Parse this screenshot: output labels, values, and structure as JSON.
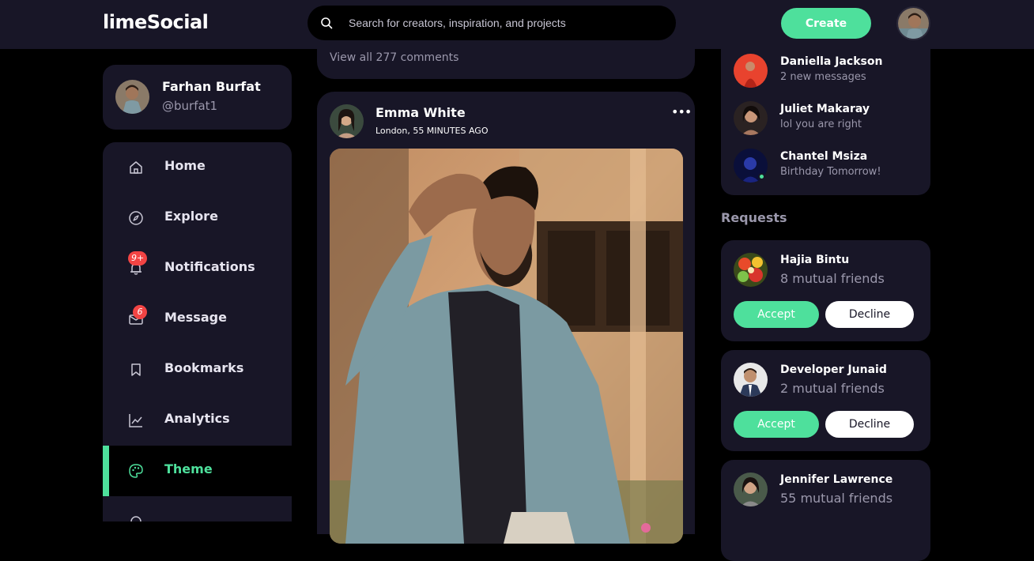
{
  "app": {
    "logo": "limeSocial",
    "accent": "#4ee09c",
    "surface": "#181627",
    "background": "#000000"
  },
  "header": {
    "search_placeholder": "Search for creators, inspiration, and projects",
    "create_label": "Create"
  },
  "profile": {
    "name": "Farhan Burfat",
    "handle": "@burfat1"
  },
  "sidebar": {
    "items": [
      {
        "label": "Home",
        "icon": "home-icon"
      },
      {
        "label": "Explore",
        "icon": "compass-icon"
      },
      {
        "label": "Notifications",
        "icon": "bell-icon",
        "badge": "9+"
      },
      {
        "label": "Message",
        "icon": "mail-icon",
        "badge": "6"
      },
      {
        "label": "Bookmarks",
        "icon": "bookmark-icon"
      },
      {
        "label": "Analytics",
        "icon": "analytics-icon"
      },
      {
        "label": "Theme",
        "icon": "palette-icon",
        "active": true
      }
    ]
  },
  "feed": {
    "previous_post": {
      "view_comments": "View all 277 comments"
    },
    "post": {
      "author": "Emma White",
      "meta": "London, 55 MINUTES AGO",
      "more": "•••"
    }
  },
  "messages": [
    {
      "name": "Daniella Jackson",
      "text": "2 new messages"
    },
    {
      "name": "Juliet Makaray",
      "text": "lol you are right"
    },
    {
      "name": "Chantel Msiza",
      "text": "Birthday Tomorrow!",
      "online": true
    }
  ],
  "requests": {
    "title": "Requests",
    "accept_label": "Accept",
    "decline_label": "Decline",
    "items": [
      {
        "name": "Hajia Bintu",
        "mutual": "8 mutual friends"
      },
      {
        "name": "Developer Junaid",
        "mutual": "2 mutual friends"
      },
      {
        "name": "Jennifer Lawrence",
        "mutual": "55 mutual friends"
      }
    ]
  }
}
